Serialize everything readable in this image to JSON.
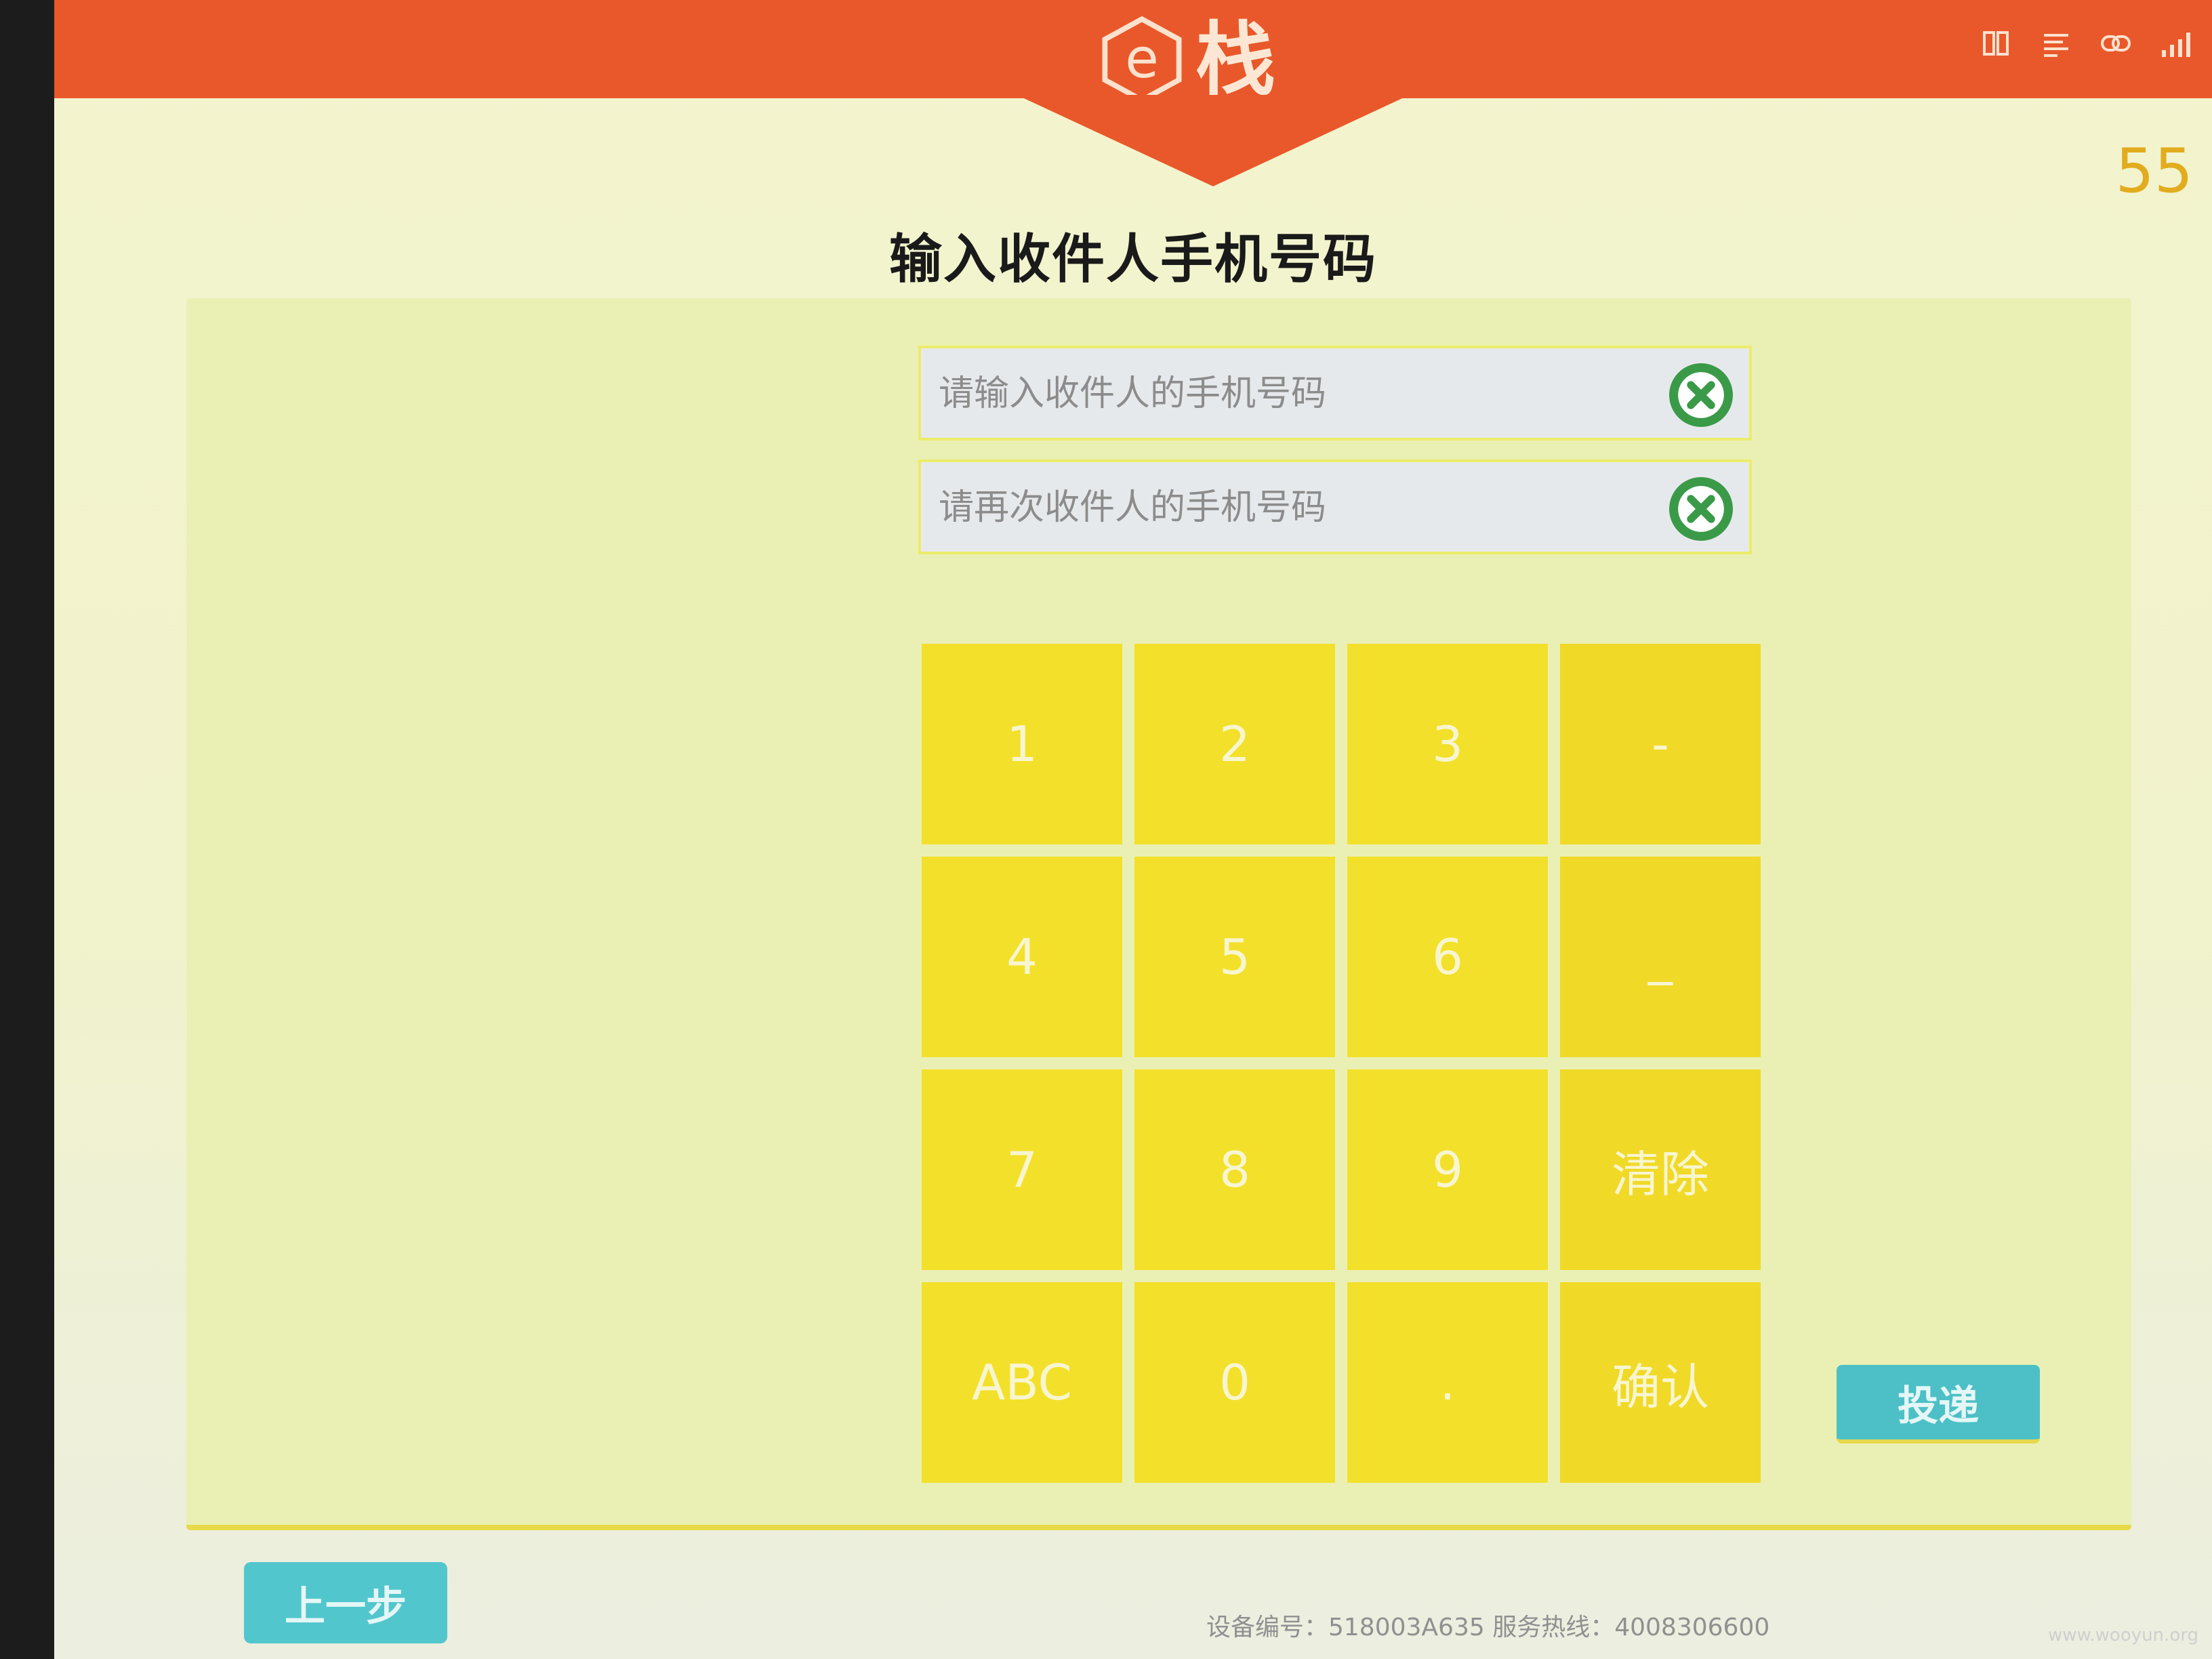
{
  "header": {
    "logo_letter": "e",
    "logo_text": "栈",
    "status_icons": [
      "sim-icon",
      "menu-icon",
      "link-icon",
      "signal-icon"
    ],
    "countdown": "55",
    "brand_color": "#e9582a"
  },
  "page": {
    "title": "输入收件人手机号码"
  },
  "form": {
    "phone_placeholder": "请输入收件人的手机号码",
    "phone_confirm_placeholder": "请再次收件人的手机号码"
  },
  "keypad": {
    "keys": [
      "1",
      "2",
      "3",
      "-",
      "4",
      "5",
      "6",
      "_",
      "7",
      "8",
      "9",
      "清除",
      "ABC",
      "0",
      ".",
      "确认"
    ]
  },
  "actions": {
    "deliver_label": "投递",
    "back_label": "上一步"
  },
  "footer": {
    "info": "设备编号：518003A635 服务热线：4008306600"
  },
  "watermark": "www.wooyun.org"
}
